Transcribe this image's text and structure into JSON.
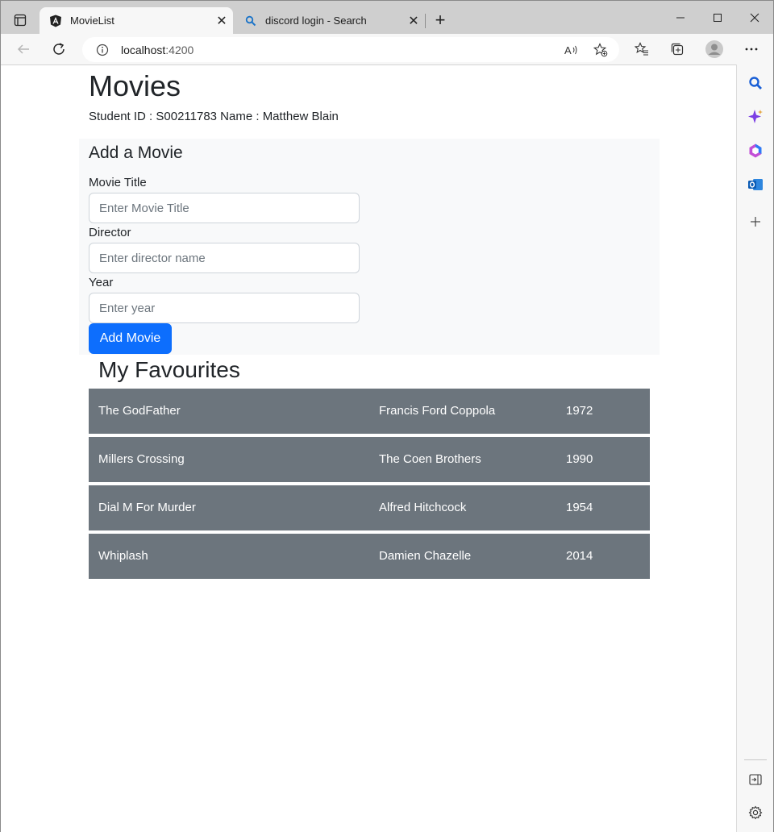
{
  "browser": {
    "tabs": [
      {
        "title": "MovieList",
        "active": true
      },
      {
        "title": "discord login - Search",
        "active": false
      }
    ],
    "url_host": "localhost",
    "url_port": ":4200"
  },
  "page": {
    "title": "Movies",
    "student_line": "Student ID : S00211783 Name : Matthew Blain",
    "form": {
      "heading": "Add a Movie",
      "title_label": "Movie Title",
      "title_placeholder": "Enter Movie Title",
      "director_label": "Director",
      "director_placeholder": "Enter director name",
      "year_label": "Year",
      "year_placeholder": "Enter year",
      "submit_label": "Add Movie"
    },
    "favourites_heading": "My Favourites",
    "movies": [
      {
        "title": "The GodFather",
        "director": "Francis Ford Coppola",
        "year": "1972"
      },
      {
        "title": "Millers Crossing",
        "director": "The Coen Brothers",
        "year": "1990"
      },
      {
        "title": "Dial M For Murder",
        "director": "Alfred Hitchcock",
        "year": "1954"
      },
      {
        "title": "Whiplash",
        "director": "Damien Chazelle",
        "year": "2014"
      }
    ]
  },
  "colors": {
    "primary_button": "#0d6efd",
    "row_background": "#6c757d",
    "panel_background": "#f8f9fa"
  }
}
